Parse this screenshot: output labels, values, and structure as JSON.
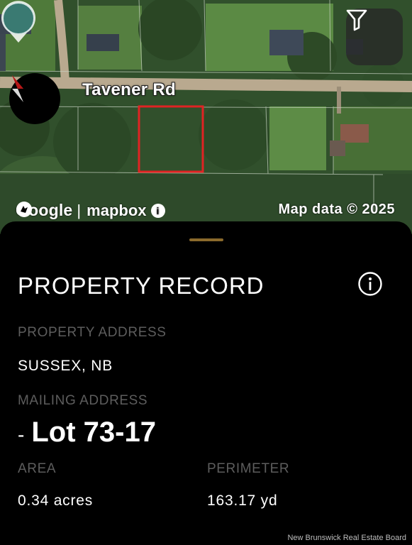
{
  "map": {
    "road_label": "Tavener Rd",
    "google_logo": "Google",
    "mapbox_logo": "mapbox",
    "info_glyph": "i",
    "copyright": "Map data © 2025",
    "filter_icon": "filter-icon",
    "compass_icon": "compass-icon",
    "pin_icon": "map-pin-icon",
    "boundary_color": "#e02323",
    "pin_color": "#3a7a72"
  },
  "record": {
    "title": "PROPERTY RECORD",
    "info_icon": "info-circle-icon",
    "property_address_label": "PROPERTY ADDRESS",
    "property_address": "SUSSEX, NB",
    "mailing_address_label": "MAILING ADDRESS",
    "mailing_dash": "-",
    "mailing_address": "Lot 73-17",
    "area_label": "AREA",
    "area_value": "0.34 acres",
    "perimeter_label": "PERIMETER",
    "perimeter_value": "163.17 yd"
  },
  "footer": {
    "credit": "New Brunswick Real Estate Board"
  },
  "colors": {
    "sheet_bg": "#000000",
    "label_gray": "#5d5d5d",
    "handle": "#8b6a2c"
  }
}
